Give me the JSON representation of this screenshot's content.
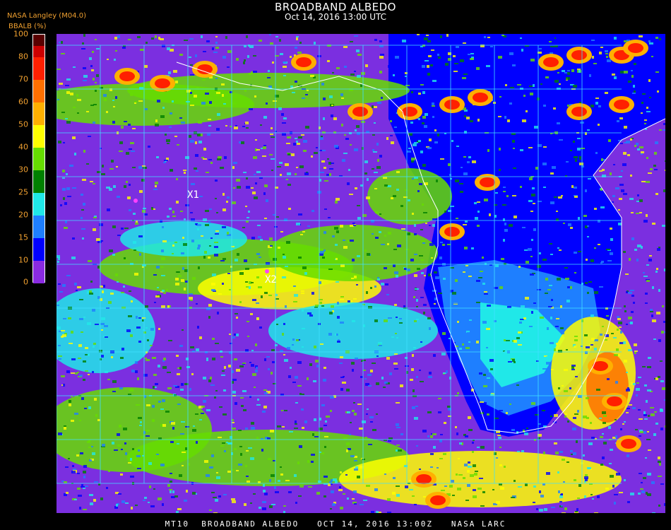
{
  "header": {
    "title": "BROADBAND ALBEDO",
    "subtitle": "Oct 14, 2016 13:00 UTC",
    "org": "NASA Langley (M04.0)",
    "units": "BBALB (%)"
  },
  "legend": {
    "ticks": [
      "100",
      "80",
      "70",
      "60",
      "50",
      "40",
      "30",
      "25",
      "20",
      "15",
      "10",
      "0"
    ],
    "colors": {
      "c0": "#8a2be2",
      "c10": "#0000ff",
      "c15": "#1e7fff",
      "c20": "#20e8e8",
      "c25": "#008000",
      "c30": "#66dd00",
      "c40": "#ffff00",
      "c50": "#ffb000",
      "c60": "#ff7000",
      "c70": "#ff2000",
      "c80": "#cc0000",
      "c100": "#5a0000"
    }
  },
  "map": {
    "grid_color": "#40e0ff",
    "coast_color": "#ffffff",
    "markers": [
      {
        "label": "X1"
      },
      {
        "label": "X2"
      }
    ]
  },
  "footer": {
    "text": "MT10  BROADBAND ALBEDO   OCT 14, 2016 13:00Z   NASA LARC"
  }
}
